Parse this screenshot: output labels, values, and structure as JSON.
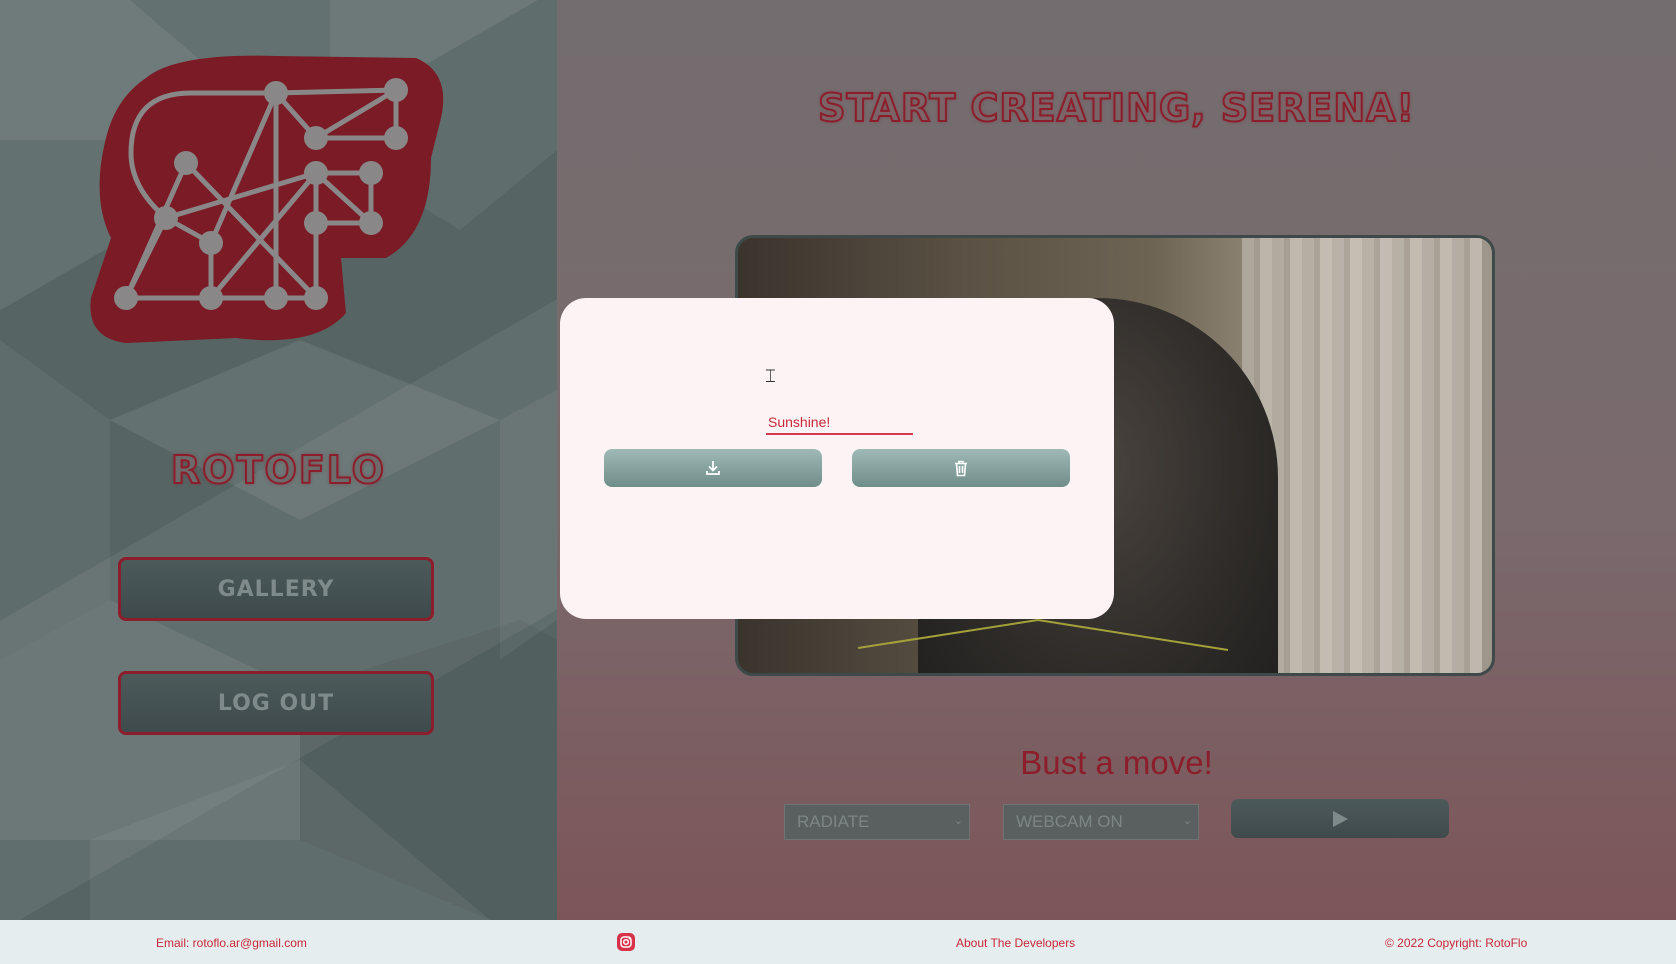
{
  "sidebar": {
    "brand_name": "ROTOFLO",
    "nav": [
      {
        "label": "GALLERY"
      },
      {
        "label": "LOG OUT"
      }
    ]
  },
  "main": {
    "title": "START CREATING, SERENA!",
    "subtitle": "Bust a move!",
    "effect_select": {
      "value": "RADIATE"
    },
    "source_select": {
      "value": "WEBCAM ON"
    },
    "play_icon": "play-icon"
  },
  "modal": {
    "name_value": "Sunshine!",
    "download_icon": "download-icon",
    "delete_icon": "trash-icon"
  },
  "footer": {
    "email": "Email: rotoflo.ar@gmail.com",
    "instagram_icon": "instagram-icon",
    "about": "About The Developers",
    "copyright": "© 2022 Copyright: RotoFlo"
  },
  "colors": {
    "brand_red": "#8c1d2a",
    "accent_red": "#c8283a",
    "sidebar_bg": "#566564",
    "modal_bg": "#fdf3f4"
  }
}
